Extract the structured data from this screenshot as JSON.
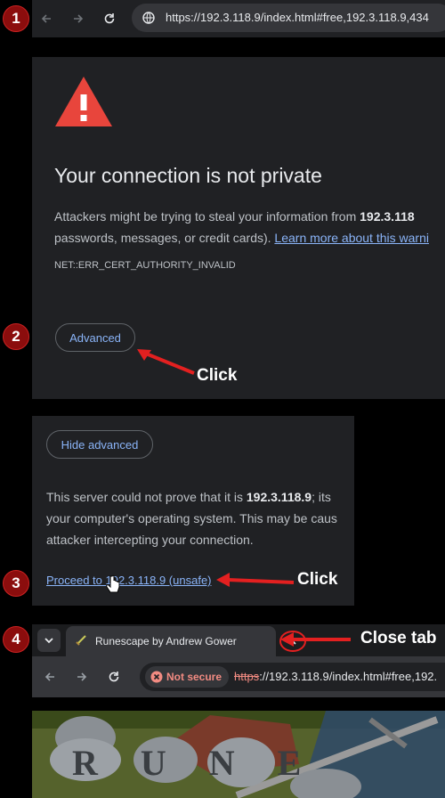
{
  "steps": [
    "1",
    "2",
    "3",
    "4"
  ],
  "browser": {
    "url": "https://192.3.118.9/index.html#free,192.3.118.9,434"
  },
  "warning": {
    "title": "Your connection is not private",
    "para_line1_prefix": "Attackers might be trying to steal your information from ",
    "para_host": "192.3.118",
    "para_line2_prefix": "passwords, messages, or credit cards). ",
    "learn_more": "Learn more about this warni",
    "error_code": "NET::ERR_CERT_AUTHORITY_INVALID",
    "advanced_button": "Advanced",
    "click_label": "Click"
  },
  "advanced": {
    "hide_button": "Hide advanced",
    "line1_prefix": "This server could not prove that it is ",
    "line1_host": "192.3.118.9",
    "line1_suffix": "; its",
    "line2": "your computer's operating system. This may be caus",
    "line3": "attacker intercepting your connection.",
    "proceed_link": "Proceed to 192.3.118.9 (unsafe)",
    "click_label": "Click"
  },
  "tabbar": {
    "tab_title": "Runescape by Andrew Gower",
    "close_tab_label": "Close tab",
    "not_secure": "Not secure",
    "url_scheme": "https",
    "url_rest": "://192.3.118.9/index.html#free,192.",
    "game_logo_text": "RUNE"
  },
  "colors": {
    "badge": "#8b0d0d",
    "arrow": "#e32020",
    "link": "#8ab4f8",
    "warning_triangle": "#e8453c"
  }
}
